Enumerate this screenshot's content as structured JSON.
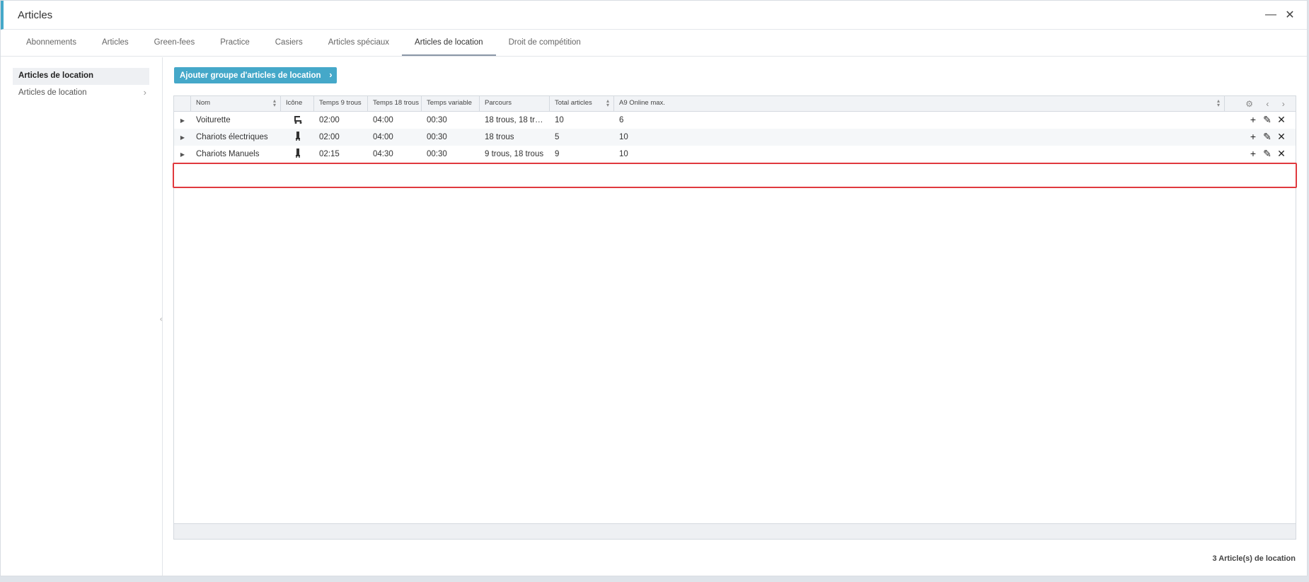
{
  "window": {
    "title": "Articles",
    "minimize_glyph": "—",
    "close_glyph": "✕"
  },
  "tabs": [
    {
      "label": "Abonnements"
    },
    {
      "label": "Articles"
    },
    {
      "label": "Green-fees"
    },
    {
      "label": "Practice"
    },
    {
      "label": "Casiers"
    },
    {
      "label": "Articles spéciaux"
    },
    {
      "label": "Articles de location",
      "active": true
    },
    {
      "label": "Droit de compétition"
    }
  ],
  "sidebar": {
    "header": "Articles de location",
    "items": [
      {
        "label": "Articles de location",
        "icon": "chevron-right-icon"
      }
    ]
  },
  "toolbar": {
    "add_button_label": "Ajouter groupe d'articles de location"
  },
  "grid": {
    "columns": [
      "Nom",
      "Icône",
      "Temps 9 trous",
      "Temps 18 trous",
      "Temps variable",
      "Parcours",
      "Total articles",
      "A9 Online max."
    ],
    "header_icons": [
      "gear-icon",
      "chevron-left-icon",
      "chevron-right-icon"
    ],
    "rows": [
      {
        "nom": "Voiturette",
        "icone": "golf-cart-icon",
        "t9": "02:00",
        "t18": "04:00",
        "tvar": "00:30",
        "parcours": "18 trous, 18 tro...",
        "total": "10",
        "online": "6"
      },
      {
        "nom": "Chariots électriques",
        "icone": "trolley-icon",
        "t9": "02:00",
        "t18": "04:00",
        "tvar": "00:30",
        "parcours": "18 trous",
        "total": "5",
        "online": "10"
      },
      {
        "nom": "Chariots Manuels",
        "icone": "trolley-icon",
        "t9": "02:15",
        "t18": "04:30",
        "tvar": "00:30",
        "parcours": "9 trous, 18 trous",
        "total": "9",
        "online": "10"
      }
    ],
    "row_actions": [
      "add-icon",
      "edit-icon",
      "delete-icon"
    ]
  },
  "footer": {
    "count_text": "3 Article(s) de location"
  },
  "colors": {
    "accent": "#45a8c9",
    "highlight": "#e0393e"
  }
}
